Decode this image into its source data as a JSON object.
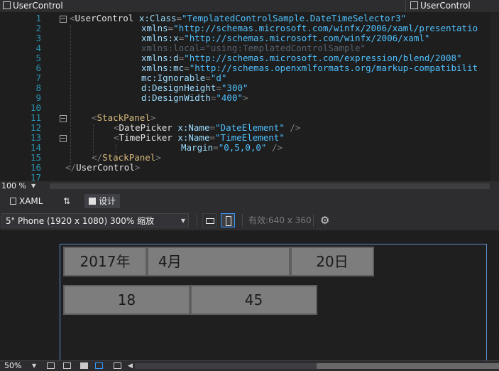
{
  "nav": {
    "left_combo": "UserControl",
    "right_combo": "UserControl"
  },
  "editor": {
    "line_numbers": [
      "1",
      "2",
      "3",
      "4",
      "5",
      "6",
      "7",
      "8",
      "9",
      "10",
      "11",
      "12",
      "13",
      "14",
      "15",
      "16",
      "17"
    ],
    "lines": {
      "l1": {
        "open": "<",
        "tag": "UserControl",
        "attr": " x:Class",
        "eq": "=",
        "val": "\"TemplatedControlSample.DateTimeSelector3\""
      },
      "l2": {
        "attr": "xmlns",
        "eq": "=",
        "val": "\"http://schemas.microsoft.com/winfx/2006/xaml/presentatio"
      },
      "l3": {
        "attr": "xmlns:x",
        "eq": "=",
        "val": "\"http://schemas.microsoft.com/winfx/2006/xaml\""
      },
      "l4": {
        "text": "xmlns:local=\"using:TemplatedControlSample\""
      },
      "l5": {
        "attr": "xmlns:d",
        "eq": "=",
        "val": "\"http://schemas.microsoft.com/expression/blend/2008\""
      },
      "l6": {
        "attr": "xmlns:mc",
        "eq": "=",
        "val": "\"http://schemas.openxmlformats.org/markup-compatibilit"
      },
      "l7": {
        "attr": "mc:Ignorable",
        "eq": "=",
        "val": "\"d\""
      },
      "l8": {
        "attr": "d:DesignHeight",
        "eq": "=",
        "val": "\"300\""
      },
      "l9": {
        "attr": "d:DesignWidth",
        "eq": "=",
        "val": "\"400\"",
        "close": ">"
      },
      "l11": {
        "open": "<",
        "tag": "StackPanel",
        "close": ">"
      },
      "l12": {
        "open": "<",
        "tag": "DatePicker",
        "attr": " x:Name",
        "eq": "=",
        "val": "\"DateElement\"",
        "close": " />"
      },
      "l13": {
        "open": "<",
        "tag": "TimePicker",
        "attr": " x:Name",
        "eq": "=",
        "val": "\"TimeElement\""
      },
      "l14": {
        "attr": "Margin",
        "eq": "=",
        "val": "\"0,5,0,0\"",
        "close": " />"
      },
      "l15": {
        "open": "</",
        "tag": "StackPanel",
        "close": ">"
      },
      "l16": {
        "open": "</",
        "tag": "UserControl",
        "close": ">"
      }
    }
  },
  "editor_zoom": "100 %",
  "tabs": {
    "xaml": "XAML",
    "swap": "⇅",
    "design": "设计"
  },
  "designer": {
    "device": "5\" Phone (1920 x 1080) 300% 缩放",
    "effective": "有效:640 x 360",
    "date": {
      "year": "2017年",
      "month": "4月",
      "day": "20日"
    },
    "time": {
      "hour": "18",
      "minute": "45"
    }
  },
  "bottom": {
    "zoom": "50%"
  }
}
